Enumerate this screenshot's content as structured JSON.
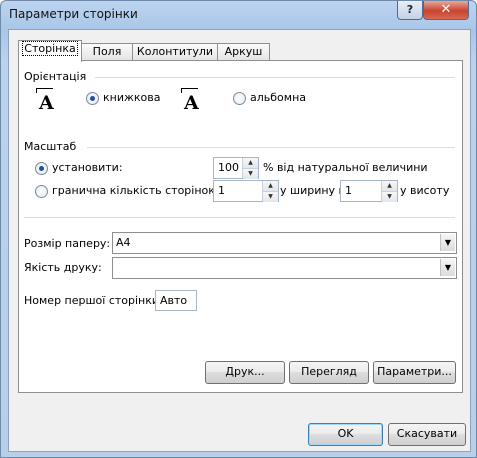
{
  "window": {
    "title": "Параметри сторінки",
    "help_label": "?",
    "close_label": "✕"
  },
  "tabs": [
    {
      "label": "Сторінка",
      "active": true
    },
    {
      "label": "Поля",
      "active": false
    },
    {
      "label": "Колонтитули",
      "active": false
    },
    {
      "label": "Аркуш",
      "active": false
    }
  ],
  "orientation": {
    "title": "Орієнтація",
    "portrait_label": "книжкова",
    "landscape_label": "альбомна",
    "icon_glyph": "A",
    "selected": "portrait"
  },
  "scale": {
    "title": "Масштаб",
    "adjust_label": "установити:",
    "adjust_value": "100",
    "adjust_suffix": "% від натуральної величини",
    "fit_label": "гранична кількість сторінок:",
    "fit_wide_value": "1",
    "fit_wide_suffix": "у ширину й",
    "fit_tall_value": "1",
    "fit_tall_suffix": "у висоту",
    "selected": "adjust"
  },
  "paper": {
    "size_label": "Розмір паперу:",
    "size_value": "A4",
    "quality_label": "Якість друку:",
    "quality_value": "",
    "first_page_label": "Номер першої сторінки:",
    "first_page_value": "Авто"
  },
  "panel_buttons": {
    "print": "Друк...",
    "preview": "Перегляд",
    "options": "Параметри..."
  },
  "footer": {
    "ok": "OK",
    "cancel": "Скасувати"
  }
}
